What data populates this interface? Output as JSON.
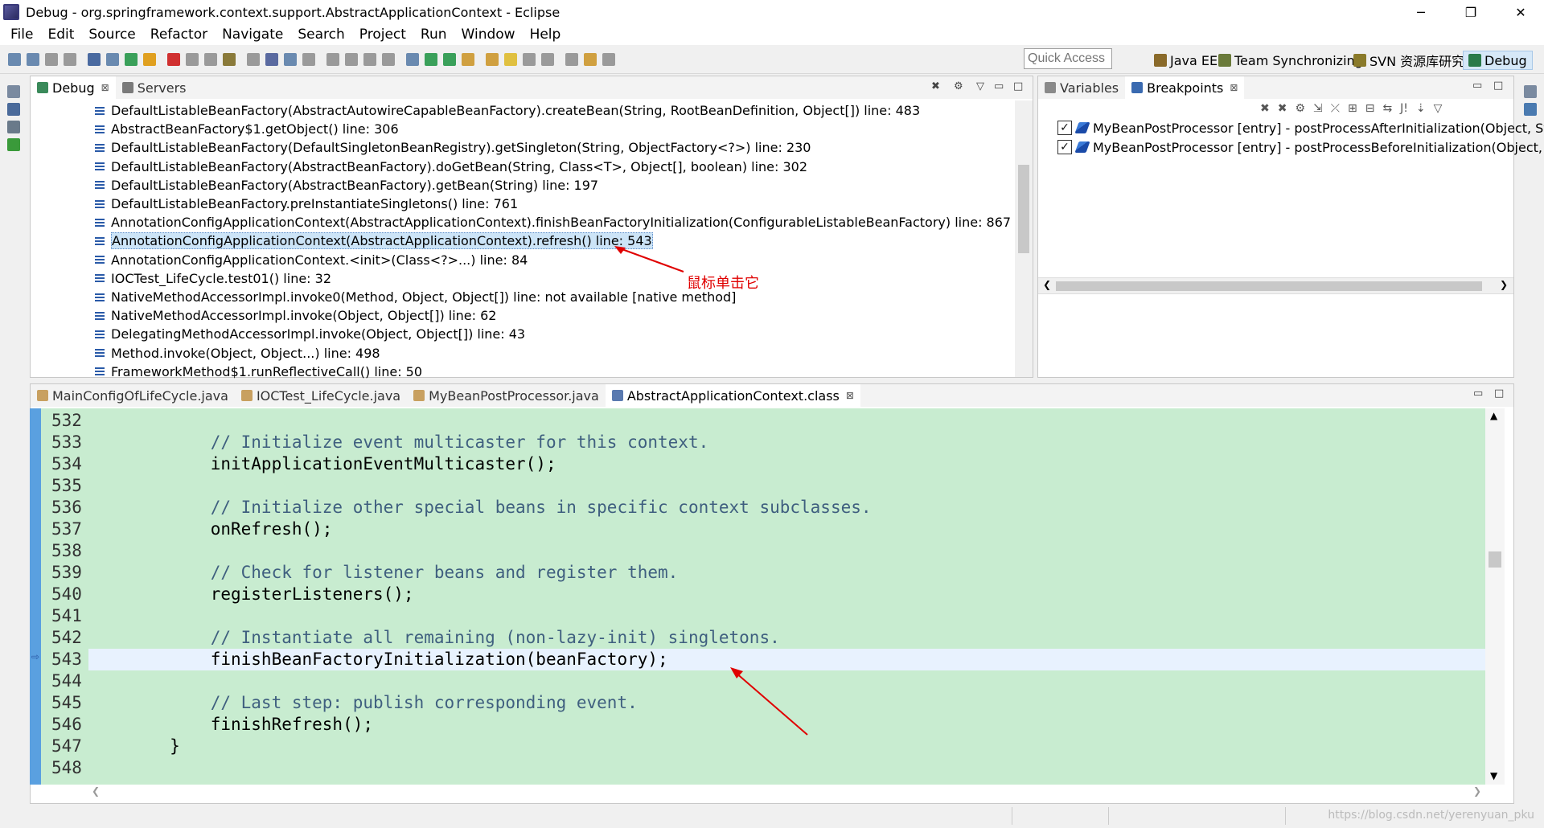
{
  "window": {
    "title": "Debug - org.springframework.context.support.AbstractApplicationContext - Eclipse",
    "min": "─",
    "max": "❐",
    "close": "✕"
  },
  "menu": [
    "File",
    "Edit",
    "Source",
    "Refactor",
    "Navigate",
    "Search",
    "Project",
    "Run",
    "Window",
    "Help"
  ],
  "toolbar": {
    "quick_access_placeholder": "Quick Access",
    "perspectives": [
      {
        "label": "Java EE",
        "color": "#8a6a2a"
      },
      {
        "label": "Team Synchronizing",
        "color": "#6a7a3a"
      },
      {
        "label": "SVN 资源库研究",
        "color": "#8a7a2a"
      },
      {
        "label": "Debug",
        "color": "#2a7a4a",
        "active": true
      }
    ]
  },
  "debug_view": {
    "tabs": [
      {
        "label": "Debug",
        "active": true,
        "closable": true
      },
      {
        "label": "Servers",
        "active": false,
        "closable": false
      }
    ],
    "frames": [
      "DefaultListableBeanFactory(AbstractAutowireCapableBeanFactory).createBean(String, RootBeanDefinition, Object[]) line: 483",
      "AbstractBeanFactory$1.getObject() line: 306",
      "DefaultListableBeanFactory(DefaultSingletonBeanRegistry).getSingleton(String, ObjectFactory<?>) line: 230",
      "DefaultListableBeanFactory(AbstractBeanFactory).doGetBean(String, Class<T>, Object[], boolean) line: 302",
      "DefaultListableBeanFactory(AbstractBeanFactory).getBean(String) line: 197",
      "DefaultListableBeanFactory.preInstantiateSingletons() line: 761",
      "AnnotationConfigApplicationContext(AbstractApplicationContext).finishBeanFactoryInitialization(ConfigurableListableBeanFactory) line: 867",
      "AnnotationConfigApplicationContext(AbstractApplicationContext).refresh() line: 543",
      "AnnotationConfigApplicationContext.<init>(Class<?>...) line: 84",
      "IOCTest_LifeCycle.test01() line: 32",
      "NativeMethodAccessorImpl.invoke0(Method, Object, Object[]) line: not available [native method]",
      "NativeMethodAccessorImpl.invoke(Object, Object[]) line: 62",
      "DelegatingMethodAccessorImpl.invoke(Object, Object[]) line: 43",
      "Method.invoke(Object, Object...) line: 498",
      "FrameworkMethod$1.runReflectiveCall() line: 50"
    ],
    "selected_index": 7,
    "annotation": "鼠标单击它"
  },
  "breakpoints_view": {
    "tabs": [
      {
        "label": "Variables",
        "active": false,
        "closable": false
      },
      {
        "label": "Breakpoints",
        "active": true,
        "closable": true
      }
    ],
    "items": [
      {
        "checked": true,
        "label": "MyBeanPostProcessor [entry] - postProcessAfterInitialization(Object, Str"
      },
      {
        "checked": true,
        "label": "MyBeanPostProcessor [entry] - postProcessBeforeInitialization(Object, S"
      }
    ]
  },
  "editor": {
    "tabs": [
      {
        "label": "MainConfigOfLifeCycle.java",
        "active": false
      },
      {
        "label": "IOCTest_LifeCycle.java",
        "active": false
      },
      {
        "label": "MyBeanPostProcessor.java",
        "active": false
      },
      {
        "label": "AbstractApplicationContext.class",
        "active": true,
        "closable": true
      }
    ],
    "current_line": 543,
    "lines": [
      {
        "n": "532",
        "text": "",
        "kind": "code"
      },
      {
        "n": "533",
        "text": "\t\t\t// Initialize event multicaster for this context.",
        "kind": "comment"
      },
      {
        "n": "534",
        "text": "\t\t\tinitApplicationEventMulticaster();",
        "kind": "code"
      },
      {
        "n": "535",
        "text": "",
        "kind": "code"
      },
      {
        "n": "536",
        "text": "\t\t\t// Initialize other special beans in specific context subclasses.",
        "kind": "comment"
      },
      {
        "n": "537",
        "text": "\t\t\tonRefresh();",
        "kind": "code"
      },
      {
        "n": "538",
        "text": "",
        "kind": "code"
      },
      {
        "n": "539",
        "text": "\t\t\t// Check for listener beans and register them.",
        "kind": "comment"
      },
      {
        "n": "540",
        "text": "\t\t\tregisterListeners();",
        "kind": "code"
      },
      {
        "n": "541",
        "text": "",
        "kind": "code"
      },
      {
        "n": "542",
        "text": "\t\t\t// Instantiate all remaining (non-lazy-init) singletons.",
        "kind": "comment"
      },
      {
        "n": "543",
        "text": "\t\t\tfinishBeanFactoryInitialization(beanFactory);",
        "kind": "code"
      },
      {
        "n": "544",
        "text": "",
        "kind": "code"
      },
      {
        "n": "545",
        "text": "\t\t\t// Last step: publish corresponding event.",
        "kind": "comment"
      },
      {
        "n": "546",
        "text": "\t\t\tfinishRefresh();",
        "kind": "code"
      },
      {
        "n": "547",
        "text": "\t\t}",
        "kind": "code"
      },
      {
        "n": "548",
        "text": "",
        "kind": "code"
      }
    ]
  },
  "status": {
    "watermark": "https://blog.csdn.net/yerenyuan_pku"
  }
}
